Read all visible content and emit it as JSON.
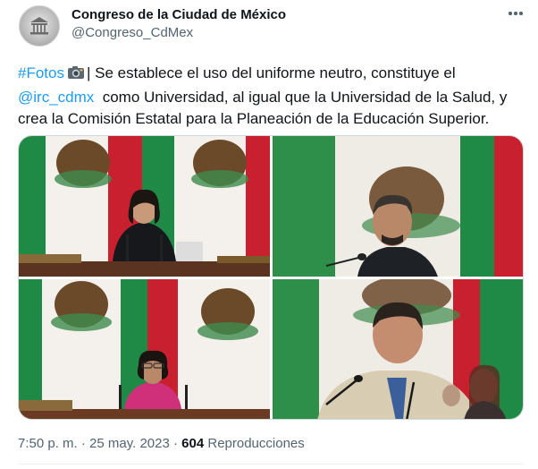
{
  "author": {
    "name": "Congreso de la Ciudad de México",
    "handle": "@Congreso_CdMex",
    "avatar_icon": "congress-seal-icon"
  },
  "menu_icon": "more-dots-icon",
  "tweet": {
    "hashtag": "#Fotos",
    "emoji_icon": "camera-icon",
    "text_part1": "| Se establece el uso del uniforme neutro, constituye el",
    "mention": "@irc_cdmx",
    "text_part2": "  como Universidad, al igual que la Universidad de la Salud, y crea la Comisión Estatal para la Planeación de la Educación Superior."
  },
  "photos": [
    {
      "subject": "woman-speaking-at-podium"
    },
    {
      "subject": "man-speaking-at-microphone"
    },
    {
      "subject": "woman-with-glasses-at-podium"
    },
    {
      "subject": "man-seated-at-microphone"
    }
  ],
  "colors": {
    "link": "#1d9bf0",
    "flag_green": "#1f8a45",
    "flag_red": "#c8202f",
    "flag_white": "#f4f1ec"
  },
  "meta": {
    "time": "7:50 p. m. · 25 may. 2023 · ",
    "views": "604",
    "views_label": " Reproducciones"
  }
}
